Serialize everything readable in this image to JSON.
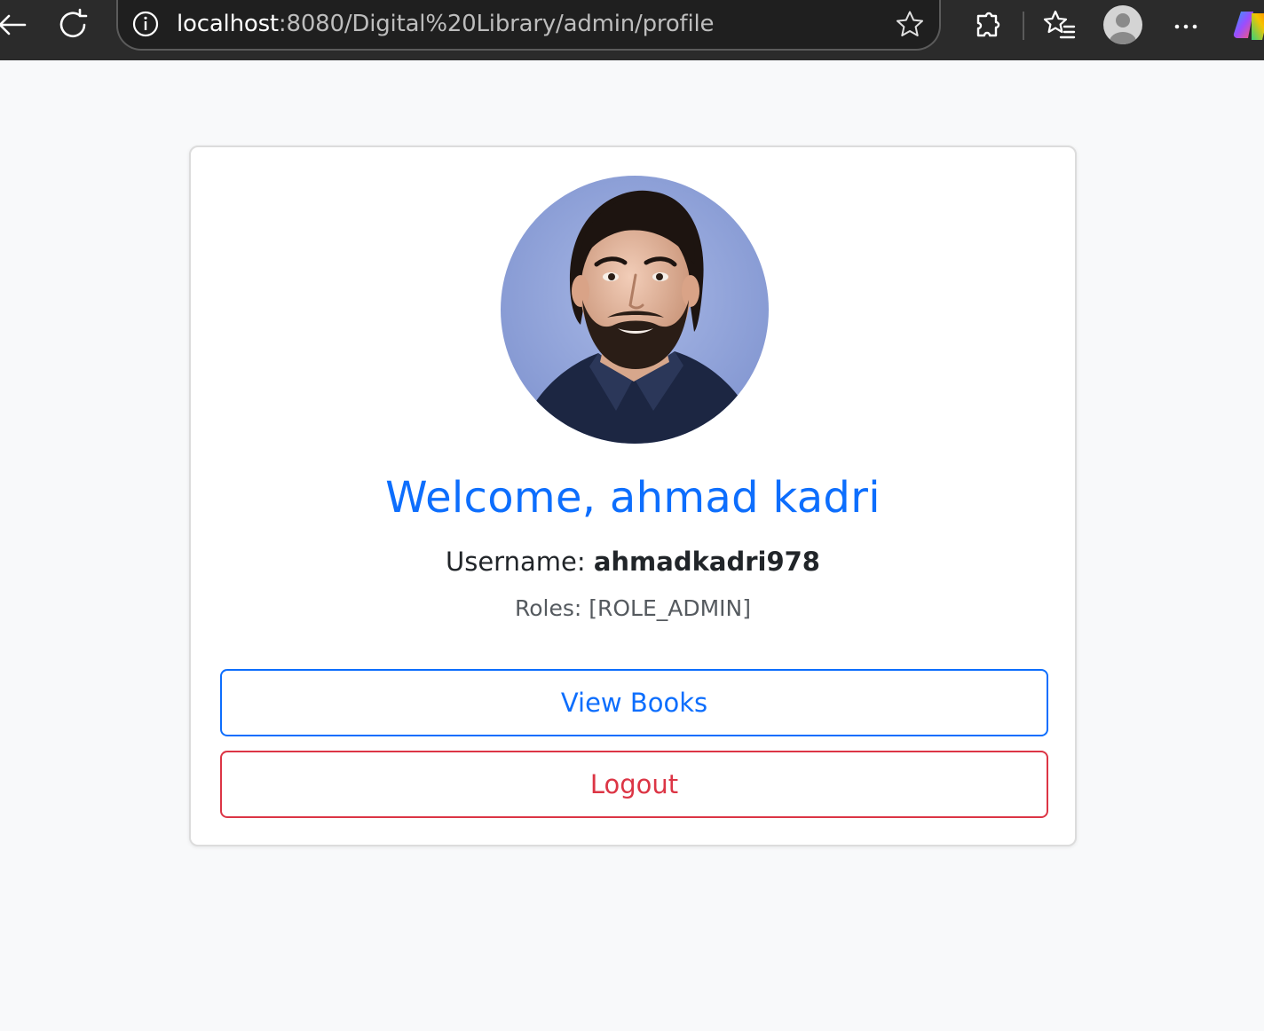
{
  "browser": {
    "url_host": "localhost",
    "url_rest": ":8080/Digital%20Library/admin/profile",
    "icons": [
      "back-icon",
      "reload-icon",
      "info-icon",
      "star-icon",
      "extensions-icon",
      "favorites-icon",
      "profile-icon",
      "more-icon",
      "copilot-icon"
    ]
  },
  "profile": {
    "welcome": "Welcome, ahmad kadri",
    "username_label": "Username:",
    "username_value": "ahmadkadri978",
    "roles_text": "Roles: [ROLE_ADMIN]"
  },
  "actions": {
    "view_books_label": "View Books",
    "logout_label": "Logout"
  },
  "colors": {
    "primary": "#0d6efd",
    "danger": "#dc3545",
    "page_bg": "#f8f9fa",
    "toolbar_bg": "#2b2b2b"
  }
}
